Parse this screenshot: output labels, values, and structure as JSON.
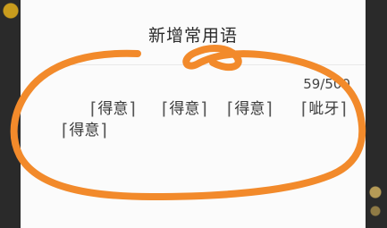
{
  "dialog": {
    "title": "新增常用语",
    "counter": "59/500",
    "phrases": [
      {
        "text": "得意"
      },
      {
        "text": "得意"
      },
      {
        "text": "得意"
      },
      {
        "text": "呲牙"
      },
      {
        "text": "得意"
      }
    ]
  },
  "annotation": {
    "stroke": "#f28a2b"
  }
}
